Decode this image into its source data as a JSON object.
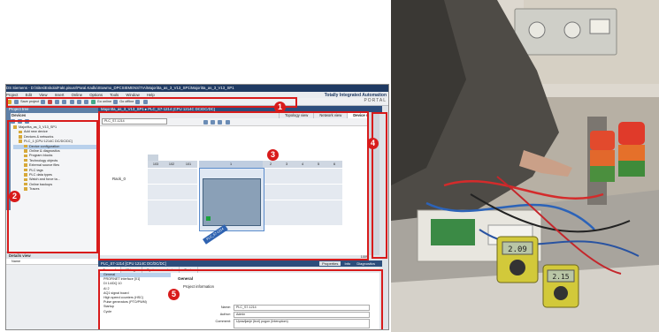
{
  "tia": {
    "title": "DS Siemens - D:\\Sites\\Eskola\\Fakt.pisusr\\Paral.Kadlu\\Stowmo_DPCSIEMENS\\TIA\\Majoritta_as_3_V13_SP1\\Majoritta_as_3_V13_SP1",
    "menu": [
      "Project",
      "Edit",
      "View",
      "Insert",
      "Online",
      "Options",
      "Tools",
      "Window",
      "Help"
    ],
    "toolbar": {
      "save_project": "Save project",
      "go_online": "Go online",
      "go_offline": "Go offline"
    },
    "brand": {
      "line1": "Totally Integrated Automation",
      "line2": "PORTAL"
    },
    "project_tree": {
      "header": "Project tree",
      "devices_label": "Devices",
      "items": [
        "Majoritta_as_3_V13_SP1",
        "Add new device",
        "Devices & networks",
        "PLC_1 [CPU 1214C DC/DC/DC]",
        "Device configuration",
        "Online & diagnostics",
        "Program blocks",
        "Technology objects",
        "External source files",
        "PLC tags",
        "PLC data types",
        "Watch and force ta...",
        "Online backups",
        "Traces"
      ]
    },
    "details_view": {
      "header": "Details view",
      "column": "Name"
    },
    "editor": {
      "breadcrumb": "Majoritta_as_3_V13_SP1 ▸ PLC_S7-1214 [CPU 1214C DC/DC/DC]",
      "views": [
        "Topology view",
        "Network view",
        "Device view"
      ],
      "device_select": "PLC_S7-1214",
      "rack_label": "Rack_0",
      "slots": [
        "103",
        "102",
        "101",
        "1",
        "2",
        "3",
        "4",
        "5",
        "6"
      ],
      "cpu_tag": "PLC_S7-1214",
      "zoom": "100%"
    },
    "properties": {
      "header": "PLC_S7-1214 [CPU 1214C DC/DC/DC]",
      "tabs": [
        "General",
        "IO tags",
        "System constants",
        "Texts"
      ],
      "right_tabs": [
        "Properties",
        "Info",
        "Diagnostics"
      ],
      "nav": [
        "General",
        "PROFINET interface [X1]",
        "DI 14/DQ 10",
        "AI 2",
        "AQ1 signal board",
        "High speed counters (HSC)",
        "Pulse generators (PTO/PWM)",
        "Startup",
        "Cycle"
      ],
      "section": "General",
      "subsection": "Project information",
      "fields": [
        {
          "label": "Name:",
          "value": "PLC_S7-1214"
        },
        {
          "label": "Author:",
          "value": "Admin"
        },
        {
          "label": "Comment:",
          "value": "Upravljanje (brzi) pogon (Interuptom)"
        }
      ]
    },
    "annotations": [
      "1",
      "2",
      "3",
      "4",
      "5"
    ]
  },
  "photo": {
    "meter_left": "2.09",
    "meter_right": "2.15"
  }
}
